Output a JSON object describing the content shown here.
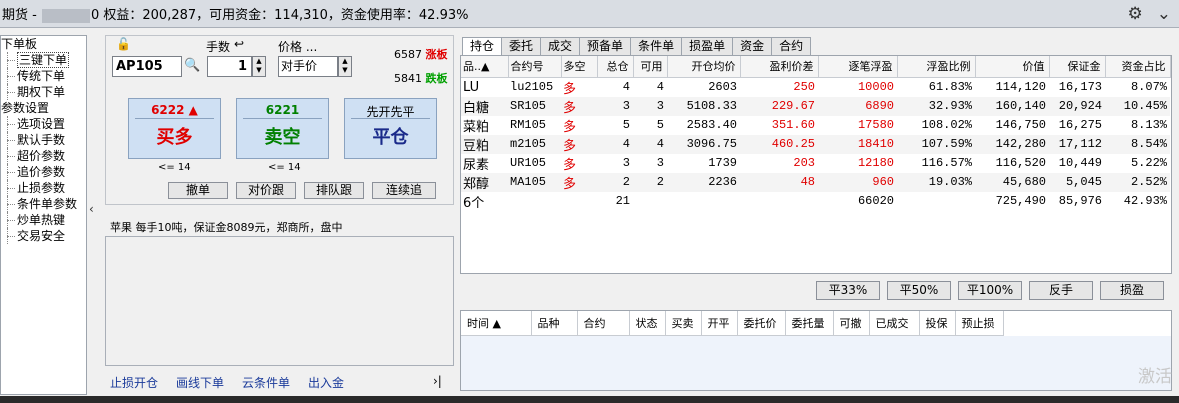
{
  "topbar": {
    "prefix": "期货 -",
    "account_suffix": "0",
    "summary": "权益：200,287，可用资金：114,310，资金使用率：42.93%",
    "gear_icon": "gear-icon",
    "collapse_icon": "chevron-down-icon"
  },
  "tree": {
    "groups": [
      {
        "label": "下单板",
        "items": [
          "三键下单",
          "传统下单",
          "期权下单"
        ]
      },
      {
        "label": "参数设置",
        "items": [
          "选项设置",
          "默认手数",
          "超价参数",
          "追价参数",
          "止损参数",
          "条件单参数",
          "炒单热键",
          "交易安全"
        ]
      }
    ]
  },
  "order": {
    "qty_label": "手数",
    "price_label": "价格 ...",
    "code": "AP105",
    "qty": "1",
    "price_type": "对手价",
    "upper_limit_value": "6587",
    "upper_limit_label": "涨板",
    "lower_limit_value": "5841",
    "lower_limit_label": "跌板",
    "buy": {
      "price": "6222",
      "label": "买多",
      "max": "<= 14"
    },
    "sell": {
      "price": "6221",
      "label": "卖空",
      "max": "<= 14"
    },
    "close": {
      "price": "先开先平",
      "label": "平仓"
    },
    "buttons": [
      "撤单",
      "对价跟",
      "排队跟",
      "连续追"
    ],
    "info": "苹果  每手10吨，保证金8089元，郑商所，盘中",
    "links": [
      "止损开仓",
      "画线下单",
      "云条件单",
      "出入金"
    ]
  },
  "tabs": [
    "持仓",
    "委托",
    "成交",
    "预备单",
    "条件单",
    "损盈单",
    "资金",
    "合约"
  ],
  "positions": {
    "headers": [
      "品..▲",
      "合约号",
      "多空",
      "总仓",
      "可用",
      "开仓均价",
      "盈利价差",
      "逐笔浮盈",
      "浮盈比例",
      "价值",
      "保证金",
      "资金占比"
    ],
    "rows": [
      [
        "LU",
        "lu2105",
        "多",
        "4",
        "4",
        "2603",
        "250",
        "10000",
        "61.83%",
        "114,120",
        "16,173",
        "8.07%"
      ],
      [
        "白糖",
        "SR105",
        "多",
        "3",
        "3",
        "5108.33",
        "229.67",
        "6890",
        "32.93%",
        "160,140",
        "20,924",
        "10.45%"
      ],
      [
        "菜粕",
        "RM105",
        "多",
        "5",
        "5",
        "2583.40",
        "351.60",
        "17580",
        "108.02%",
        "146,750",
        "16,275",
        "8.13%"
      ],
      [
        "豆粕",
        "m2105",
        "多",
        "4",
        "4",
        "3096.75",
        "460.25",
        "18410",
        "107.59%",
        "142,280",
        "17,112",
        "8.54%"
      ],
      [
        "尿素",
        "UR105",
        "多",
        "3",
        "3",
        "1739",
        "203",
        "12180",
        "116.57%",
        "116,520",
        "10,449",
        "5.22%"
      ],
      [
        "郑醇",
        "MA105",
        "多",
        "2",
        "2",
        "2236",
        "48",
        "960",
        "19.03%",
        "45,680",
        "5,045",
        "2.52%"
      ]
    ],
    "total": [
      "6个",
      "",
      "",
      "21",
      "",
      "",
      "",
      "66020",
      "",
      "725,490",
      "85,976",
      "42.93%"
    ]
  },
  "actions": [
    "平33%",
    "平50%",
    "平100%",
    "反手",
    "损盈"
  ],
  "orders_headers": [
    "时间 ▲",
    "品种",
    "合约",
    "状态",
    "买卖",
    "开平",
    "委托价",
    "委托量",
    "可撤",
    "已成交",
    "投保",
    "预止损"
  ],
  "watermark": "激活",
  "colors": {
    "up": "#e00000",
    "down": "#008000",
    "accent": "#cfe0f3"
  }
}
